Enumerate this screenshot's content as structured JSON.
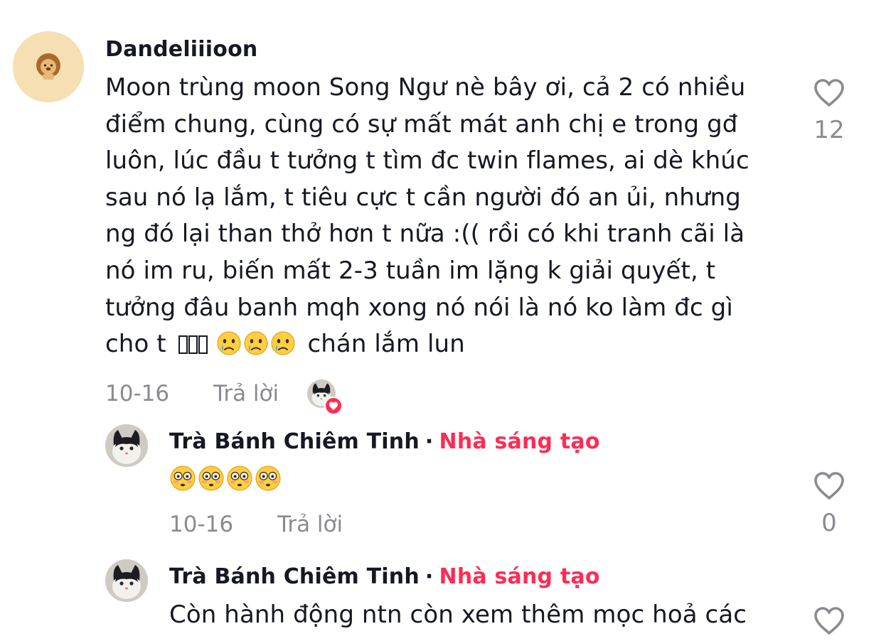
{
  "comments": [
    {
      "username": "Dandeliiioon",
      "text_lines": [
        "Moon trùng moon Song Ngư nè bây ơi, cả 2 có nhiều",
        "điểm chung, cùng có sự mất mát anh chị e trong gđ",
        "luôn, lúc đầu t tưởng t tìm đc twin flames, ai dè khúc",
        "sau nó lạ lắm, t tiêu cực t cần người đó an ủi, nhưng",
        "ng đó lại than thở hơn t nữa :(( rồi có khi tranh cãi là",
        "nó im ru, biến mất 2-3 tuần im lặng k giải quyết, t",
        "tưởng đâu banh mqh xong nó nói là nó ko làm đc gì"
      ],
      "last_line_prefix": "cho t",
      "last_line_suffix": "chán lắm lun",
      "date": "10-16",
      "reply_label": "Trả lời",
      "like_count": "12"
    },
    {
      "username": "Trà Bánh Chiêm Tinh",
      "separator": "·",
      "badge": "Nhà sáng tạo",
      "date": "10-16",
      "reply_label": "Trả lời",
      "like_count": "0"
    },
    {
      "username": "Trà Bánh Chiêm Tinh",
      "separator": "·",
      "badge": "Nhà sáng tạo",
      "text": "Còn hành động ntn còn xem thêm mọc hoả các"
    }
  ],
  "icons": {
    "like": "heart-outline-icon",
    "crying": "crying-face-emoji",
    "flushed": "flushed-face-emoji",
    "creator_like": "heart-icon"
  },
  "colors": {
    "creator_badge": "#fe2c55",
    "muted_text": "#8a8b91",
    "primary_text": "#161823"
  }
}
